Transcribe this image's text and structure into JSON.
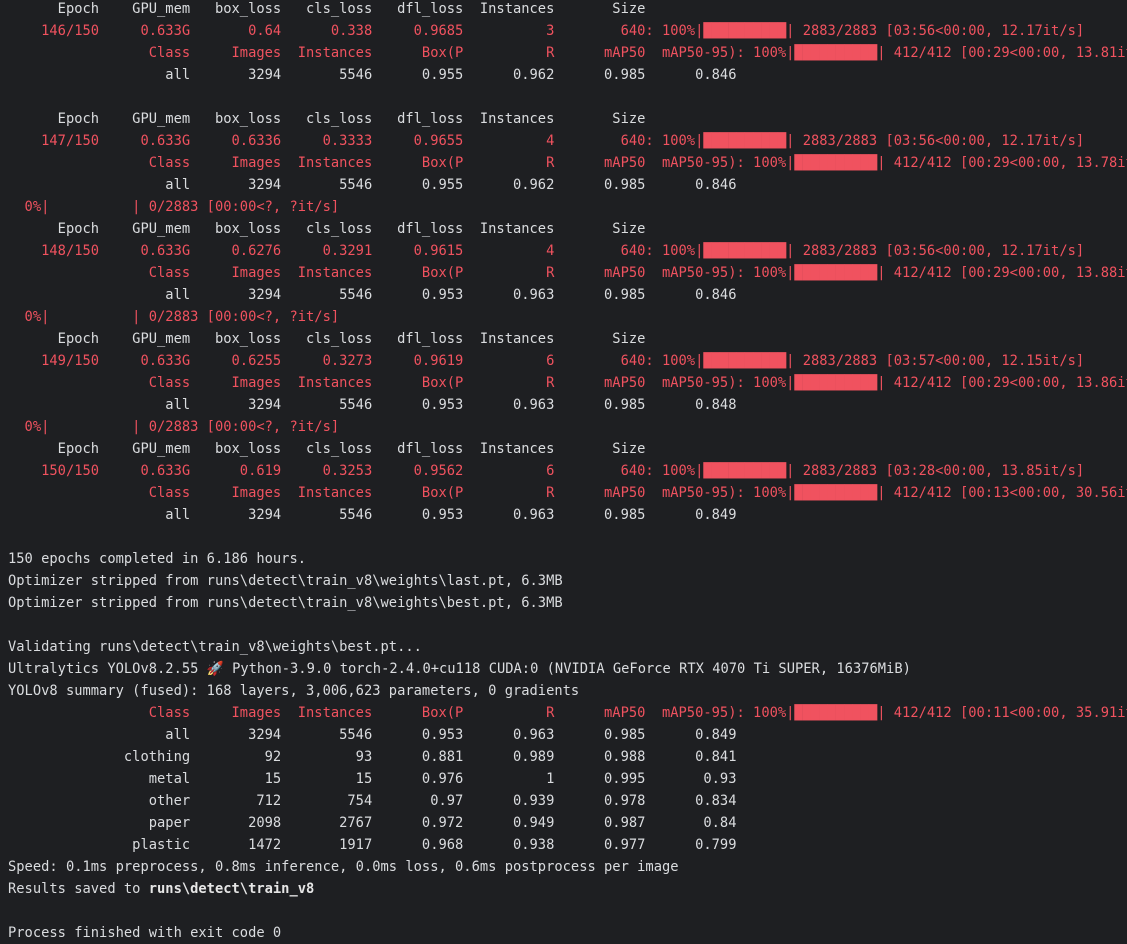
{
  "colors": {
    "background": "#1e1f22",
    "stdout_text": "#dadcdf",
    "stderr_text": "#f0525f"
  },
  "console": {
    "lines": [
      [
        {
          "t": "      Epoch    GPU_mem   box_loss   cls_loss   dfl_loss  Instances       Size",
          "c": "white"
        }
      ],
      [
        {
          "t": "    146/150     0.633G       0.64      0.338     0.9685          3        640: 100%|██████████| 2883/2883 [03:56<00:00, 12.17it/s]",
          "c": "red"
        }
      ],
      [
        {
          "t": "                 Class     Images  Instances      Box(P          R      mAP50  mAP50-95): 100%|██████████| 412/412 [00:29<00:00, 13.81it/s]",
          "c": "red"
        }
      ],
      [
        {
          "t": "                   all       3294       5546      0.955      0.962      0.985      0.846",
          "c": "white"
        }
      ],
      [
        {
          "t": "",
          "c": "white"
        }
      ],
      [
        {
          "t": "      Epoch    GPU_mem   box_loss   cls_loss   dfl_loss  Instances       Size",
          "c": "white"
        }
      ],
      [
        {
          "t": "    147/150     0.633G     0.6336     0.3333     0.9655          4        640: 100%|██████████| 2883/2883 [03:56<00:00, 12.17it/s]",
          "c": "red"
        }
      ],
      [
        {
          "t": "                 Class     Images  Instances      Box(P          R      mAP50  mAP50-95): 100%|██████████| 412/412 [00:29<00:00, 13.78it/s]",
          "c": "red"
        }
      ],
      [
        {
          "t": "                   all       3294       5546      0.955      0.962      0.985      0.846",
          "c": "white"
        }
      ],
      [
        {
          "t": "  0%|          | 0/2883 [00:00<?, ?it/s]",
          "c": "red"
        }
      ],
      [
        {
          "t": "      Epoch    GPU_mem   box_loss   cls_loss   dfl_loss  Instances       Size",
          "c": "white"
        }
      ],
      [
        {
          "t": "    148/150     0.633G     0.6276     0.3291     0.9615          4        640: 100%|██████████| 2883/2883 [03:56<00:00, 12.17it/s]",
          "c": "red"
        }
      ],
      [
        {
          "t": "                 Class     Images  Instances      Box(P          R      mAP50  mAP50-95): 100%|██████████| 412/412 [00:29<00:00, 13.88it/s]",
          "c": "red"
        }
      ],
      [
        {
          "t": "                   all       3294       5546      0.953      0.963      0.985      0.846",
          "c": "white"
        }
      ],
      [
        {
          "t": "  0%|          | 0/2883 [00:00<?, ?it/s]",
          "c": "red"
        }
      ],
      [
        {
          "t": "      Epoch    GPU_mem   box_loss   cls_loss   dfl_loss  Instances       Size",
          "c": "white"
        }
      ],
      [
        {
          "t": "    149/150     0.633G     0.6255     0.3273     0.9619          6        640: 100%|██████████| 2883/2883 [03:57<00:00, 12.15it/s]",
          "c": "red"
        }
      ],
      [
        {
          "t": "                 Class     Images  Instances      Box(P          R      mAP50  mAP50-95): 100%|██████████| 412/412 [00:29<00:00, 13.86it/s]",
          "c": "red"
        }
      ],
      [
        {
          "t": "                   all       3294       5546      0.953      0.963      0.985      0.848",
          "c": "white"
        }
      ],
      [
        {
          "t": "  0%|          | 0/2883 [00:00<?, ?it/s]",
          "c": "red"
        }
      ],
      [
        {
          "t": "      Epoch    GPU_mem   box_loss   cls_loss   dfl_loss  Instances       Size",
          "c": "white"
        }
      ],
      [
        {
          "t": "    150/150     0.633G      0.619     0.3253     0.9562          6        640: 100%|██████████| 2883/2883 [03:28<00:00, 13.85it/s]",
          "c": "red"
        }
      ],
      [
        {
          "t": "                 Class     Images  Instances      Box(P          R      mAP50  mAP50-95): 100%|██████████| 412/412 [00:13<00:00, 30.56it/s]",
          "c": "red"
        }
      ],
      [
        {
          "t": "                   all       3294       5546      0.953      0.963      0.985      0.849",
          "c": "white"
        }
      ],
      [
        {
          "t": "",
          "c": "white"
        }
      ],
      [
        {
          "t": "150 epochs completed in 6.186 hours.",
          "c": "white"
        }
      ],
      [
        {
          "t": "Optimizer stripped from runs\\detect\\train_v8\\weights\\last.pt, 6.3MB",
          "c": "white"
        }
      ],
      [
        {
          "t": "Optimizer stripped from runs\\detect\\train_v8\\weights\\best.pt, 6.3MB",
          "c": "white"
        }
      ],
      [
        {
          "t": "",
          "c": "white"
        }
      ],
      [
        {
          "t": "Validating runs\\detect\\train_v8\\weights\\best.pt...",
          "c": "white"
        }
      ],
      [
        {
          "t": "Ultralytics YOLOv8.2.55 🚀 Python-3.9.0 torch-2.4.0+cu118 CUDA:0 (NVIDIA GeForce RTX 4070 Ti SUPER, 16376MiB)",
          "c": "white"
        }
      ],
      [
        {
          "t": "YOLOv8 summary (fused): 168 layers, 3,006,623 parameters, 0 gradients",
          "c": "white"
        }
      ],
      [
        {
          "t": "                 Class     Images  Instances      Box(P          R      mAP50  mAP50-95): 100%|██████████| 412/412 [00:11<00:00, 35.91it/s]",
          "c": "red"
        }
      ],
      [
        {
          "t": "                   all       3294       5546      0.953      0.963      0.985      0.849",
          "c": "white"
        }
      ],
      [
        {
          "t": "              clothing         92         93      0.881      0.989      0.988      0.841",
          "c": "white"
        }
      ],
      [
        {
          "t": "                 metal         15         15      0.976          1      0.995       0.93",
          "c": "white"
        }
      ],
      [
        {
          "t": "                 other        712        754       0.97      0.939      0.978      0.834",
          "c": "white"
        }
      ],
      [
        {
          "t": "                 paper       2098       2767      0.972      0.949      0.987       0.84",
          "c": "white"
        }
      ],
      [
        {
          "t": "               plastic       1472       1917      0.968      0.938      0.977      0.799",
          "c": "white"
        }
      ],
      [
        {
          "t": "Speed: 0.1ms preprocess, 0.8ms inference, 0.0ms loss, 0.6ms postprocess per image",
          "c": "white"
        }
      ],
      [
        {
          "t": "Results saved to ",
          "c": "white"
        },
        {
          "t": "runs\\detect\\train_v8",
          "c": "bold"
        }
      ],
      [
        {
          "t": "",
          "c": "white"
        }
      ],
      [
        {
          "t": "Process finished with exit code 0",
          "c": "white"
        }
      ]
    ]
  }
}
